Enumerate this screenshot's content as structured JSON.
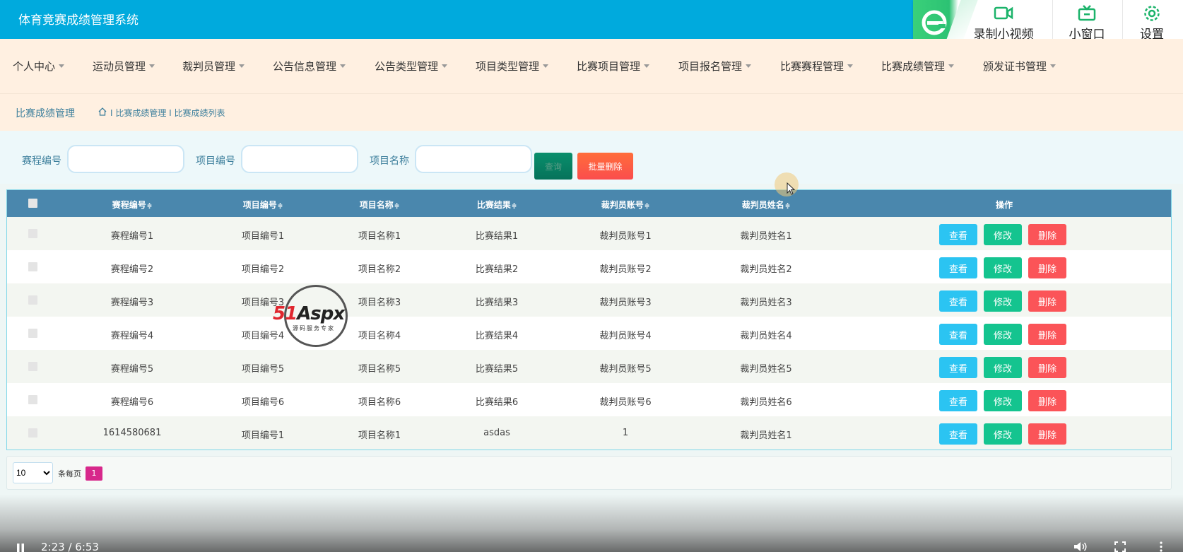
{
  "app": {
    "title": "体育竞赛成绩管理系统"
  },
  "video_toolbar": {
    "record_label": "录制小视频",
    "mini_label": "小窗口",
    "settings_label": "设置"
  },
  "nav": {
    "items": [
      {
        "label": "个人中心"
      },
      {
        "label": "运动员管理"
      },
      {
        "label": "裁判员管理"
      },
      {
        "label": "公告信息管理"
      },
      {
        "label": "公告类型管理"
      },
      {
        "label": "项目类型管理"
      },
      {
        "label": "比赛项目管理"
      },
      {
        "label": "项目报名管理"
      },
      {
        "label": "比赛赛程管理"
      },
      {
        "label": "比赛成绩管理"
      },
      {
        "label": "颁发证书管理"
      }
    ]
  },
  "breadcrumb": {
    "title": "比赛成绩管理",
    "path": "I 比赛成绩管理 I 比赛成绩列表"
  },
  "search": {
    "label1": "赛程编号",
    "label2": "项目编号",
    "label3": "项目名称",
    "query_label": "查询",
    "batch_delete_label": "批量删除"
  },
  "table": {
    "sort_mark": "≑",
    "headers": [
      "赛程编号",
      "项目编号",
      "项目名称",
      "比赛结果",
      "裁判员账号",
      "裁判员姓名",
      "操作"
    ],
    "rows": [
      [
        "赛程编号1",
        "项目编号1",
        "项目名称1",
        "比赛结果1",
        "裁判员账号1",
        "裁判员姓名1"
      ],
      [
        "赛程编号2",
        "项目编号2",
        "项目名称2",
        "比赛结果2",
        "裁判员账号2",
        "裁判员姓名2"
      ],
      [
        "赛程编号3",
        "项目编号3",
        "项目名称3",
        "比赛结果3",
        "裁判员账号3",
        "裁判员姓名3"
      ],
      [
        "赛程编号4",
        "项目编号4",
        "项目名称4",
        "比赛结果4",
        "裁判员账号4",
        "裁判员姓名4"
      ],
      [
        "赛程编号5",
        "项目编号5",
        "项目名称5",
        "比赛结果5",
        "裁判员账号5",
        "裁判员姓名5"
      ],
      [
        "赛程编号6",
        "项目编号6",
        "项目名称6",
        "比赛结果6",
        "裁判员账号6",
        "裁判员姓名6"
      ],
      [
        "1614580681",
        "项目编号1",
        "项目名称1",
        "asdas",
        "1",
        "裁判员姓名1"
      ]
    ],
    "actions": {
      "view": "查看",
      "edit": "修改",
      "delete": "删除"
    }
  },
  "pager": {
    "page_size": "10",
    "per_page_label": "条每页",
    "current_page": "1"
  },
  "watermark": {
    "brand_red": "51",
    "brand_black": "Aspx",
    "tagline": "源码服务专家"
  },
  "video": {
    "time": "2:23 / 6:53"
  },
  "colors": {
    "header": "#00aadd",
    "nav_bg": "#fff0e1",
    "thead": "#4a87ad",
    "view": "#2bc4f2",
    "edit": "#14c48f",
    "delete": "#fb5458",
    "page_active": "#d7288b"
  }
}
